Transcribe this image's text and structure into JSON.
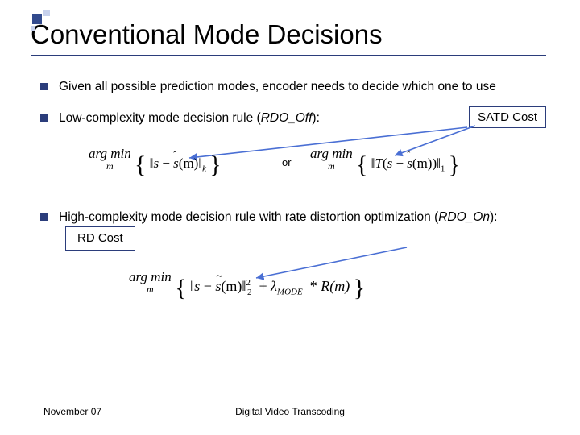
{
  "title": "Conventional Mode Decisions",
  "bullets": {
    "b1": "Given all possible prediction modes, encoder needs to decide which one to use",
    "b2_prefix": "Low-complexity mode decision rule (",
    "b2_em": "RDO_Off",
    "b2_suffix": "):",
    "b3_prefix": "High-complexity mode decision rule with rate distortion optimization (",
    "b3_em": "RDO_On",
    "b3_suffix": "):"
  },
  "labels": {
    "satd": "SATD Cost",
    "rd": "RD Cost",
    "or": "or"
  },
  "formula": {
    "argmin": "arg min",
    "m": "m",
    "s": "s",
    "shat": "s",
    "stilde": "s",
    "of_m": "(m)",
    "T": "T",
    "norm_k": "k",
    "norm_1": "1",
    "norm_2": "2",
    "lambda": "λ",
    "lambda_sub": "MODE",
    "R": "R(m)",
    "star": "*",
    "plus": "+",
    "minus": "−"
  },
  "footer": {
    "left": "November 07",
    "center": "Digital Video Transcoding"
  }
}
